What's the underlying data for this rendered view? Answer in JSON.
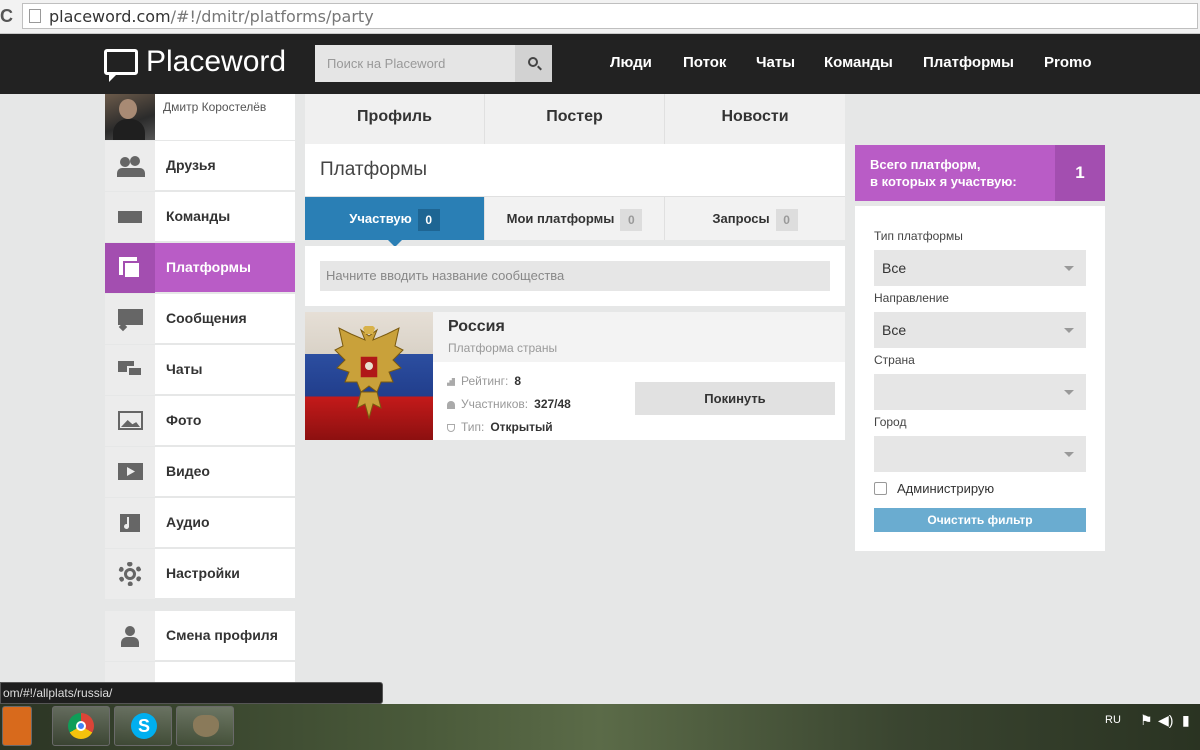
{
  "browser": {
    "url_host": "placeword.com",
    "url_path": "/#!/dmitr/platforms/party"
  },
  "header": {
    "logo_text": "Placeword",
    "search_placeholder": "Поиск на Placeword",
    "nav": [
      "Люди",
      "Поток",
      "Чаты",
      "Команды",
      "Платформы",
      "Promo"
    ]
  },
  "user": {
    "name": "Дмитр Коростелёв"
  },
  "sidebar": {
    "items": [
      {
        "label": "Друзья",
        "icon": "friends-icon"
      },
      {
        "label": "Команды",
        "icon": "teams-icon"
      },
      {
        "label": "Платформы",
        "icon": "platforms-icon",
        "active": true
      },
      {
        "label": "Сообщения",
        "icon": "messages-icon"
      },
      {
        "label": "Чаты",
        "icon": "chats-icon"
      },
      {
        "label": "Фото",
        "icon": "photo-icon"
      },
      {
        "label": "Видео",
        "icon": "video-icon"
      },
      {
        "label": "Аудио",
        "icon": "audio-icon"
      },
      {
        "label": "Настройки",
        "icon": "settings-icon"
      }
    ],
    "switch_profile": "Смена профиля"
  },
  "profile_tabs": [
    "Профиль",
    "Постер",
    "Новости"
  ],
  "section_title": "Платформы",
  "subtabs": [
    {
      "label": "Участвую",
      "count": "0",
      "active": true
    },
    {
      "label": "Мои платформы",
      "count": "0"
    },
    {
      "label": "Запросы",
      "count": "0"
    }
  ],
  "community_search_placeholder": "Начните вводить название сообщества",
  "platform_card": {
    "name": "Россия",
    "type_label": "Платформа страны",
    "rating_label": "Рейтинг:",
    "rating": "8",
    "members_label": "Участников:",
    "members": "327/48",
    "kind_label": "Тип:",
    "kind": "Открытый",
    "leave_label": "Покинуть"
  },
  "right_panel": {
    "total_label_line1": "Всего платформ,",
    "total_label_line2": "в которых я участвую:",
    "total_count": "1",
    "filter_type_label": "Тип платформы",
    "filter_type_value": "Все",
    "filter_direction_label": "Направление",
    "filter_direction_value": "Все",
    "filter_country_label": "Страна",
    "filter_city_label": "Город",
    "admin_checkbox_label": "Администрирую",
    "clear_filter_label": "Очистить фильтр"
  },
  "status_bar": "om/#!/allplats/russia/",
  "taskbar": {
    "language": "RU"
  },
  "colors": {
    "accent_purple": "#b95cc6",
    "accent_blue": "#2a7fb5",
    "header_bg": "#222222"
  }
}
